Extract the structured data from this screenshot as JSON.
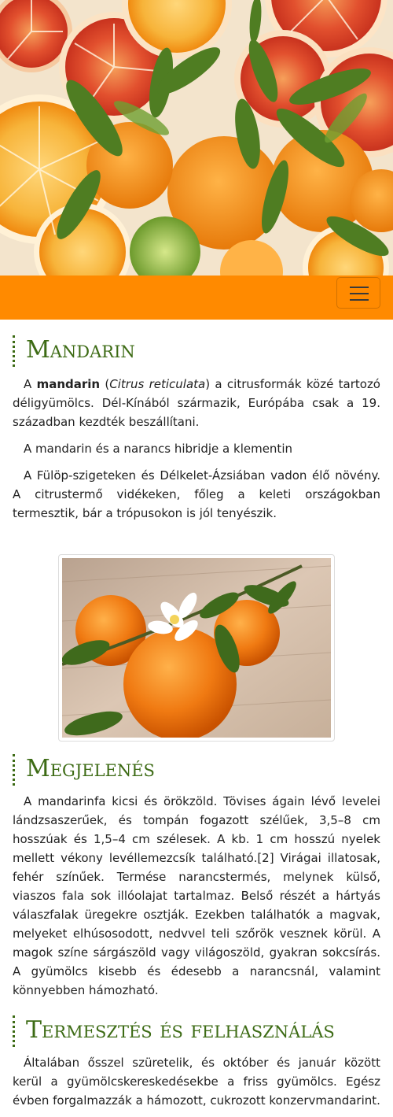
{
  "hero": {
    "image": "citrus-fruits-photo",
    "colors": {
      "orange": "#f29018",
      "blood_orange": "#d9452c",
      "lime": "#7fa93c",
      "leaf": "#4f7d22"
    }
  },
  "navbar": {
    "color": "#ff8a00",
    "toggler_icon": "hamburger-menu-icon"
  },
  "sections": {
    "mandarin": {
      "title": "Mandarin",
      "intro_a": "A ",
      "intro_bold": "mandarin",
      "intro_b": " (",
      "intro_italic": "Citrus reticulata",
      "intro_c": ") a citrusformák közé tartozó déligyümölcs. Dél-Kínából származik, Európába csak a 19. században kezdték beszállítani.",
      "p2": "A mandarin és a narancs hibridje a klementin",
      "p3": "A Fülöp-szigeteken és Délkelet-Ázsiában vadon élő növény. A citrustermő vidékeken, főleg a keleti országokban termesztik, bár a trópusokon is jól tenyészik."
    },
    "figure": {
      "image": "mandarins-with-blossom-photo"
    },
    "megjelenes": {
      "title": "Megjelenés",
      "text": "A mandarinfa kicsi és örökzöld. Tövises ágain lévő levelei lándzsaszerűek, és tompán fogazott szélűek, 3,5–8 cm hosszúak és 1,5–4 cm szélesek. A kb. 1 cm hosszú nyelek mellett vékony levéllemezcsík található.[2] Virágai illatosak, fehér színűek. Termése narancstermés, melynek külső, viaszos fala sok illóolajat tartalmaz. Belső részét a hártyás válaszfalak üregekre osztják. Ezekben találhatók a magvak, melyeket elhúsosodott, nedvvel teli szőrök vesznek körül. A magok színe sárgászöld vagy világoszöld, gyakran sokcsírás. A gyümölcs kisebb és édesebb a narancsnál, valamint könnyebben hámozható."
    },
    "termesztes": {
      "title": "Termesztés és felhasználás",
      "text": "Általában ősszel szüretelik, és október és január között kerül a gyümölcskereskedésekbe a friss gyümölcs. Egész évben forgalmazzák a hámozott, cukrozott konzervmandarint."
    }
  }
}
